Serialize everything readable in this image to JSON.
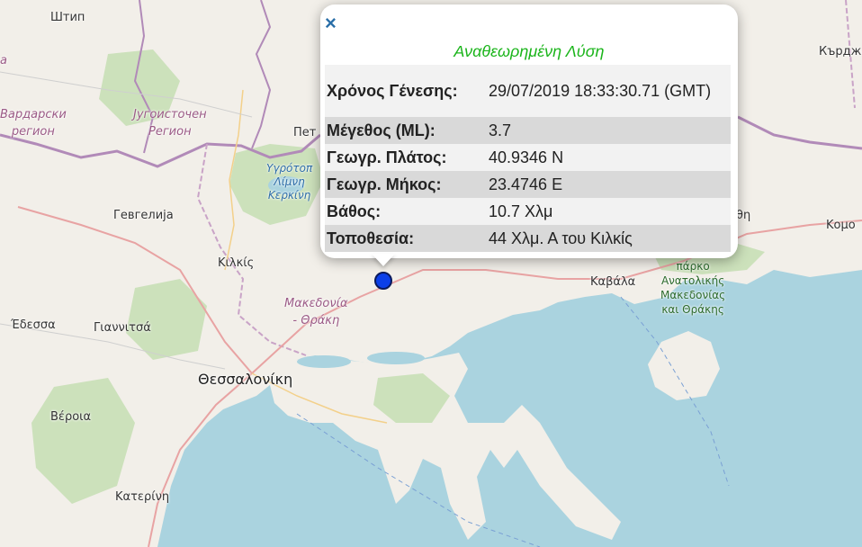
{
  "map_labels": {
    "shtip": "Штип",
    "vardarski": "Вардарски",
    "vardarski2": "регион",
    "yugoistochen": "Југоисточен",
    "yugoistochen2": "Регион",
    "pet": "Пет",
    "gevgelija": "Гевгелија",
    "lake1": "Υγρότοπ",
    "lake2": "Λίμνη",
    "lake3": "Κερκίνη",
    "kilkis": "Κιλκίς",
    "makedonia": "Μακεδονία",
    "thraki": "- Θράκη",
    "edessa": "Έδεσσα",
    "giannitsa": "Γιαννιτσά",
    "thessaloniki": "Θεσσαλονίκη",
    "veroia": "Βέροια",
    "katerini": "Κατερίνη",
    "kavala": "Καβάλα",
    "park1": "πάρκο",
    "park2": "Ανατολικής",
    "park3": "Μακεδονίας",
    "park4": "και Θράκης",
    "kardzhali": "Кърджа",
    "komotini": "Κομο",
    "left_edge": "а",
    "drama_frag": "θη"
  },
  "popup": {
    "close_label": "×",
    "title": "Αναθεωρημένη Λύση",
    "rows": [
      {
        "label": "Χρόνος Γένεσης:",
        "value": "29/07/2019 18:33:30.71 (GMT)"
      },
      {
        "label": "Μέγεθος (ML):",
        "value": "3.7"
      },
      {
        "label": "Γεωγρ. Πλάτος:",
        "value": "40.9346 N"
      },
      {
        "label": "Γεωγρ. Μήκος:",
        "value": "23.4746 E"
      },
      {
        "label": "Βάθος:",
        "value": "10.7 Χλμ"
      },
      {
        "label": "Τοποθεσία:",
        "value": "44 Χλμ. Α του Κιλκίς"
      }
    ]
  },
  "colors": {
    "land": "#f2efe9",
    "sea": "#aad3df",
    "forest": "#c8dfb6",
    "border": "#b18ab8",
    "marker": "#0b3fe8",
    "title_green": "#1bb51b"
  }
}
